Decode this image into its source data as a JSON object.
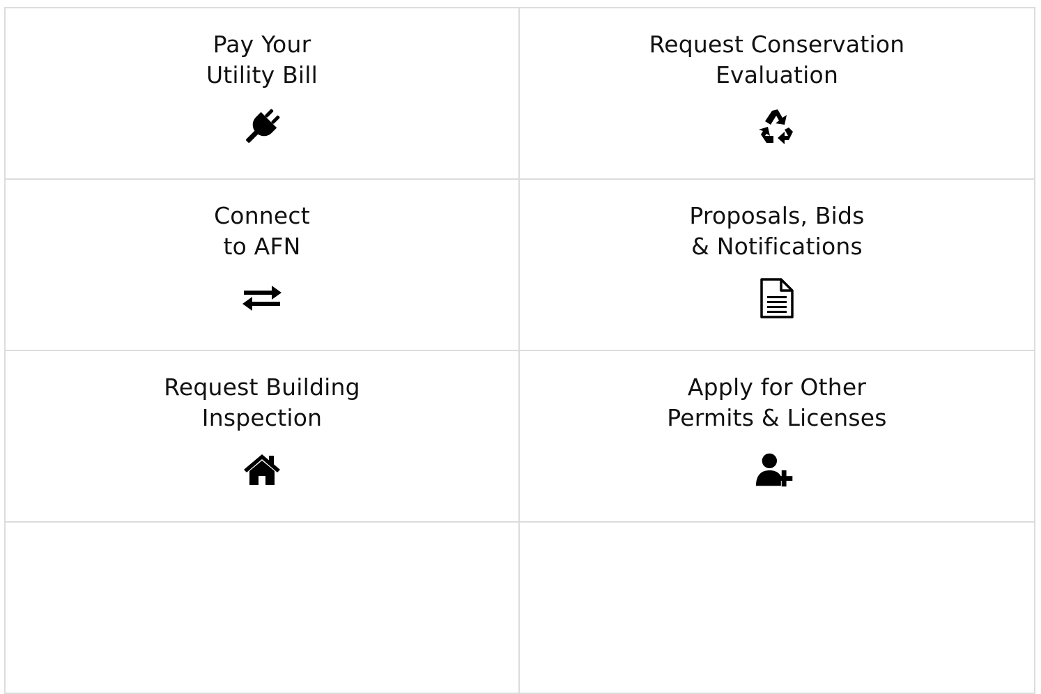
{
  "tiles": [
    {
      "line1": "Pay Your",
      "line2": "Utility Bill",
      "icon": "plug-icon"
    },
    {
      "line1": "Request Conservation",
      "line2": "Evaluation",
      "icon": "recycle-icon"
    },
    {
      "line1": "Connect",
      "line2": "to AFN",
      "icon": "exchange-arrows-icon"
    },
    {
      "line1": "Proposals, Bids",
      "line2": "& Notifications",
      "icon": "document-icon"
    },
    {
      "line1": "Request Building",
      "line2": "Inspection",
      "icon": "home-icon"
    },
    {
      "line1": "Apply for Other",
      "line2": "Permits & Licenses",
      "icon": "user-plus-icon"
    }
  ],
  "colors": {
    "border": "#dcdcdc",
    "text": "#111111",
    "icon": "#000000"
  }
}
